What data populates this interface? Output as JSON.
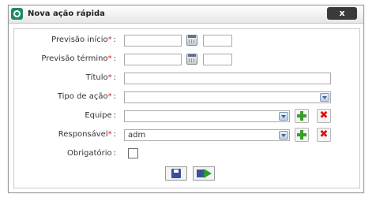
{
  "dialog": {
    "title": "Nova ação rápida",
    "close_label": "x"
  },
  "form": {
    "required_mark": "*",
    "colon": ":",
    "previsao_inicio": {
      "label": "Previsão início",
      "date": "",
      "time": ""
    },
    "previsao_termino": {
      "label": "Previsão término",
      "date": "",
      "time": ""
    },
    "titulo": {
      "label": "Título",
      "value": ""
    },
    "tipo_acao": {
      "label": "Tipo de ação",
      "selected": ""
    },
    "equipe": {
      "label": "Equipe",
      "selected": ""
    },
    "responsavel": {
      "label": "Responsável",
      "selected": "adm"
    },
    "obrigatorio": {
      "label": "Obrigatório",
      "checked": false
    }
  }
}
